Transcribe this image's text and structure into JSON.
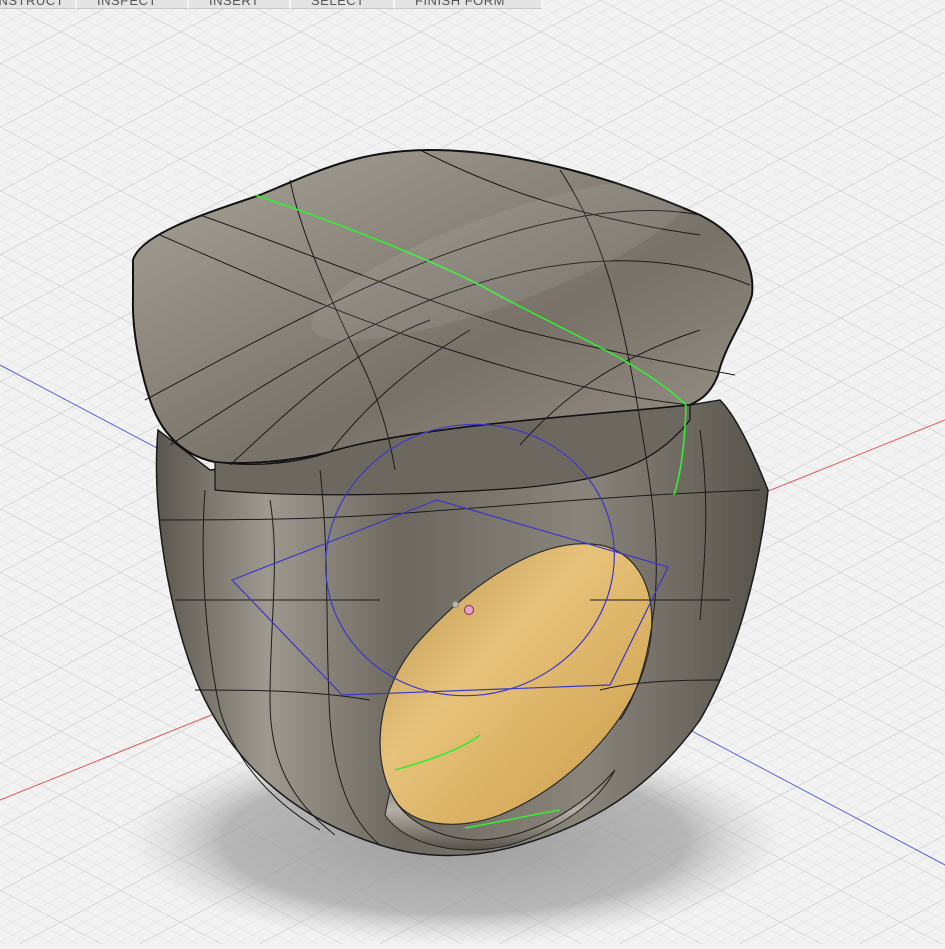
{
  "toolbar": {
    "tabs": [
      {
        "id": "construct",
        "label": "CONSTRUCT"
      },
      {
        "id": "inspect",
        "label": "INSPECT"
      },
      {
        "id": "insert",
        "label": "INSERT"
      },
      {
        "id": "select",
        "label": "SELECT"
      },
      {
        "id": "finish-form",
        "label": "FINISH FORM"
      }
    ]
  },
  "colors": {
    "background": "#f2f2f2",
    "grid_minor": "#dedede",
    "grid_major": "#c6c6c6",
    "x_axis": "#e05555",
    "y_axis": "#5561d8",
    "body_light": "#a49e94",
    "body_dark": "#4a4640",
    "inner_band": "#d6a850",
    "edge_highlight": "#33ee33",
    "sketch_outline": "#3b37c8"
  },
  "model": {
    "type": "ring",
    "display": "t-spline surface with control-cage edges"
  }
}
